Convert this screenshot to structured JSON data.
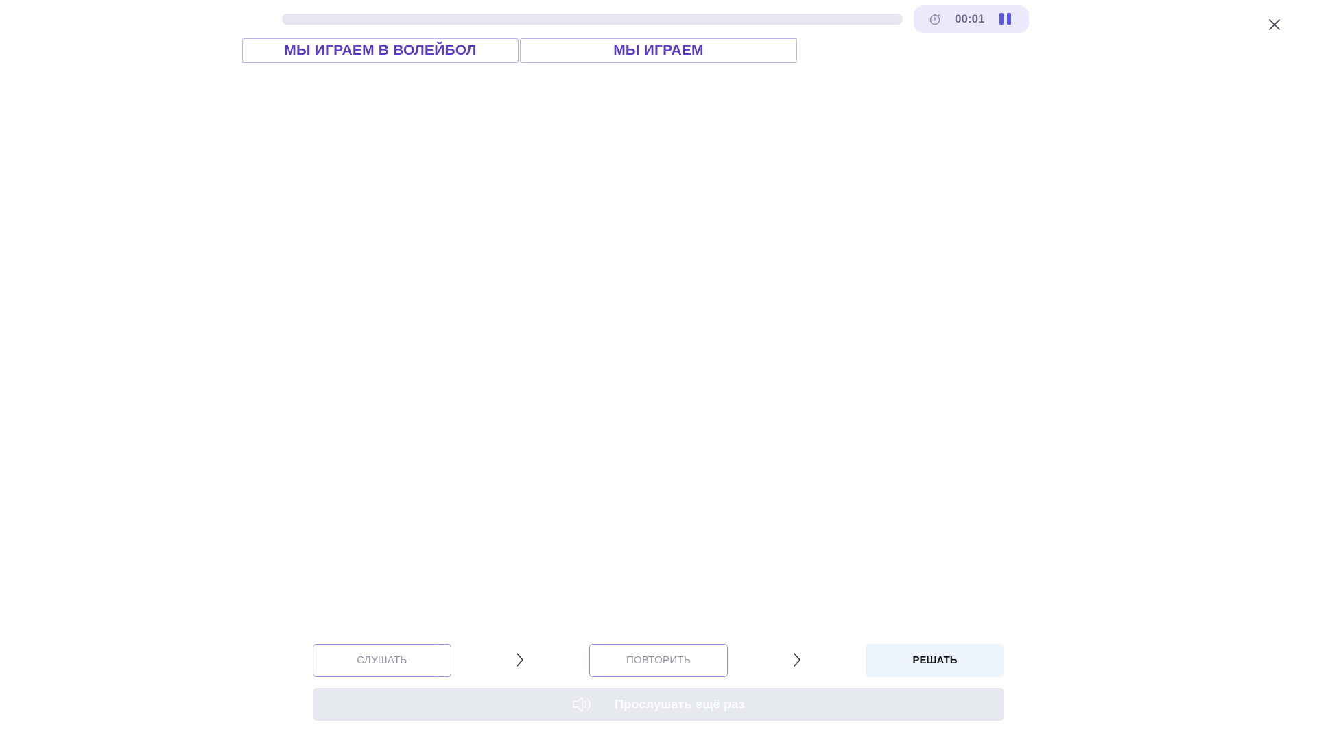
{
  "progress": {
    "fraction": 0.0
  },
  "timer": {
    "time": "00:01",
    "icon": "stopwatch-icon"
  },
  "pause": {
    "icon": "pause-icon"
  },
  "close": {
    "icon": "close-icon"
  },
  "phrases": [
    {
      "text": "МЫ ИГРАЕМ В ВОЛЕЙБОЛ"
    },
    {
      "text": "МЫ ИГРАЕМ"
    }
  ],
  "steps": [
    {
      "label": "СЛУШАТЬ"
    },
    {
      "label": "ПОВТОРИТЬ"
    },
    {
      "label": "РЕШАТЬ"
    }
  ],
  "replay": {
    "label": "Прослушать ещё раз",
    "icon": "speaker-icon"
  },
  "colors": {
    "accent": "#5a57e6",
    "chip_text": "#5a3cc0",
    "chip_border": "#b9b4ea",
    "step_border": "#a68ee8",
    "timer_bg": "#ebe9fb",
    "replay_bg": "#e6e9ee"
  }
}
